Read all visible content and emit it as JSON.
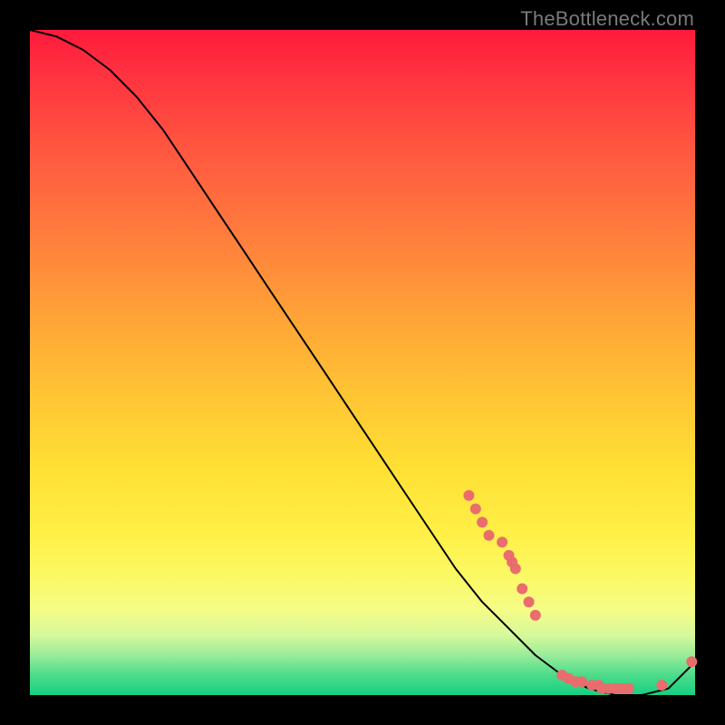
{
  "watermark": "TheBottleneck.com",
  "chart_data": {
    "type": "line",
    "title": "",
    "xlabel": "",
    "ylabel": "",
    "xlim": [
      0,
      100
    ],
    "ylim": [
      0,
      100
    ],
    "legend": false,
    "grid": false,
    "series": [
      {
        "name": "bottleneck-curve",
        "x": [
          0,
          4,
          8,
          12,
          16,
          20,
          24,
          28,
          32,
          36,
          40,
          44,
          48,
          52,
          56,
          60,
          64,
          68,
          72,
          76,
          80,
          84,
          88,
          92,
          96,
          100
        ],
        "y": [
          100,
          99,
          97,
          94,
          90,
          85,
          79,
          73,
          67,
          61,
          55,
          49,
          43,
          37,
          31,
          25,
          19,
          14,
          10,
          6,
          3,
          1,
          0,
          0,
          1,
          5
        ]
      }
    ],
    "markers": {
      "name": "highlighted-points",
      "color": "#e96d6d",
      "x": [
        66,
        67,
        68,
        69,
        71,
        72,
        72.5,
        73,
        74,
        75,
        76,
        80,
        81,
        82,
        83,
        84.5,
        85.5,
        86,
        87,
        88,
        89,
        90,
        95,
        99.5
      ],
      "y": [
        30,
        28,
        26,
        24,
        23,
        21,
        20,
        19,
        16,
        14,
        12,
        3,
        2.5,
        2,
        2,
        1.5,
        1.5,
        1,
        1,
        1,
        1,
        1,
        1.5,
        5
      ]
    },
    "background_gradient": {
      "direction": "vertical",
      "stops": [
        {
          "pos": 0.0,
          "color": "#ff1a3a"
        },
        {
          "pos": 0.3,
          "color": "#ff7a3d"
        },
        {
          "pos": 0.66,
          "color": "#ffe033"
        },
        {
          "pos": 0.87,
          "color": "#f6fc86"
        },
        {
          "pos": 1.0,
          "color": "#17cf82"
        }
      ]
    }
  }
}
